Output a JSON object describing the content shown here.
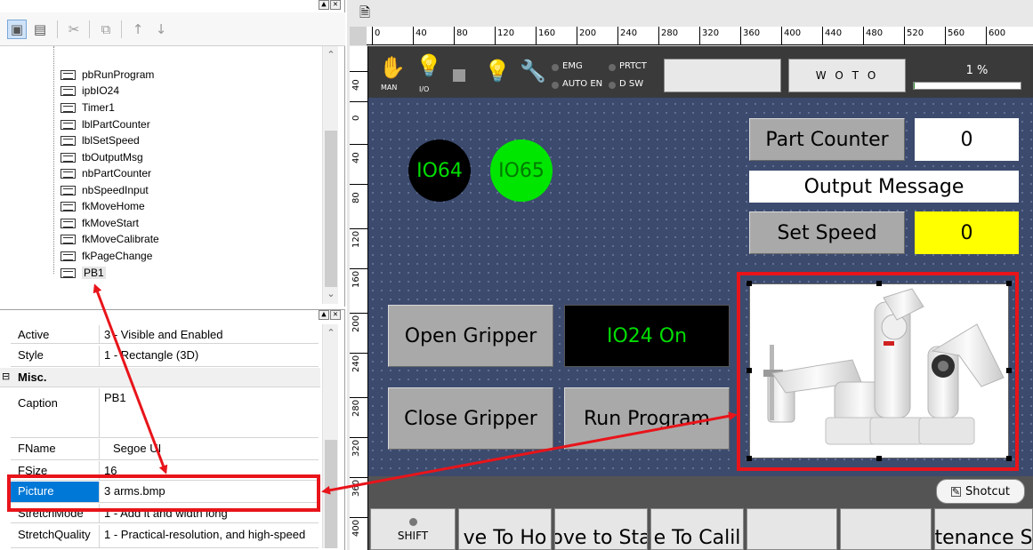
{
  "window_buttons": [
    "▲",
    "✕"
  ],
  "toolbar": {
    "icons": [
      "objects-tab-icon",
      "page-tab-icon",
      "cut-icon",
      "copy-icon",
      "move-up-icon",
      "move-down-icon"
    ],
    "glyphs": [
      "▣",
      "▤",
      "✂",
      "⧉",
      "↑",
      "↓"
    ]
  },
  "tree": {
    "items": [
      "pbRunProgram",
      "ipbIO24",
      "Timer1",
      "lblPartCounter",
      "lblSetSpeed",
      "tbOutputMsg",
      "nbPartCounter",
      "nbSpeedInput",
      "fkMoveHome",
      "fkMoveStart",
      "fkMoveCalibrate",
      "fkPageChange",
      "PB1"
    ],
    "selected": "PB1"
  },
  "properties": {
    "rows_top": [
      {
        "name": "Active",
        "value": "3 - Visible and Enabled"
      },
      {
        "name": "Style",
        "value": "1 - Rectangle (3D)"
      }
    ],
    "category": "Misc.",
    "category_toggle": "⊟",
    "rows": [
      {
        "name": "Caption",
        "value": "PB1"
      },
      {
        "name": "FName",
        "value": "Segoe UI"
      },
      {
        "name": "FSize",
        "value": "16"
      },
      {
        "name": "Picture",
        "value": "3 arms.bmp"
      },
      {
        "name": "StretchMode",
        "value": "1 - Add it and width long"
      },
      {
        "name": "StretchQuality",
        "value": "1 - Practical-resolution, and high-speed"
      }
    ]
  },
  "ruler": {
    "h_labels": [
      "0",
      "40",
      "80",
      "120",
      "160",
      "200",
      "240",
      "280",
      "320",
      "360",
      "400",
      "440",
      "480",
      "520",
      "560",
      "600"
    ],
    "v_labels": [
      "40",
      "0",
      "40",
      "80",
      "120",
      "160",
      "200",
      "240",
      "280",
      "320",
      "360",
      "400"
    ]
  },
  "status_bar": {
    "man_label": "MAN",
    "io_label": "I/O",
    "emg": "EMG",
    "prtct": "PRTCT",
    "auto_en": "AUTO EN",
    "dsw": "D SW",
    "mode_button": "",
    "woto_button": "W O T O",
    "speed_percent": "1 %",
    "speed_progress": 0.01
  },
  "screen": {
    "io64": "IO64",
    "io65": "IO65",
    "part_counter_label": "Part Counter",
    "part_counter_value": "0",
    "output_message": "Output Message",
    "set_speed_label": "Set Speed",
    "set_speed_value": "0",
    "open_gripper": "Open Gripper",
    "io24_on": "IO24 On",
    "close_gripper": "Close Gripper",
    "run_program": "Run Program"
  },
  "shortcut_button": "Shotcut",
  "bottom_buttons": [
    "SHIFT",
    "ve To Ho",
    "ove to Sta",
    "e To Calil",
    "",
    "",
    "tenance S"
  ],
  "colors": {
    "canvas": "#3c4a6e",
    "io64_bg": "#000000",
    "io65_bg": "#00e600",
    "io_text": "#00dd00",
    "speed_box": "#ffff00",
    "highlight": "#e8141a",
    "selection": "#0078d7"
  }
}
